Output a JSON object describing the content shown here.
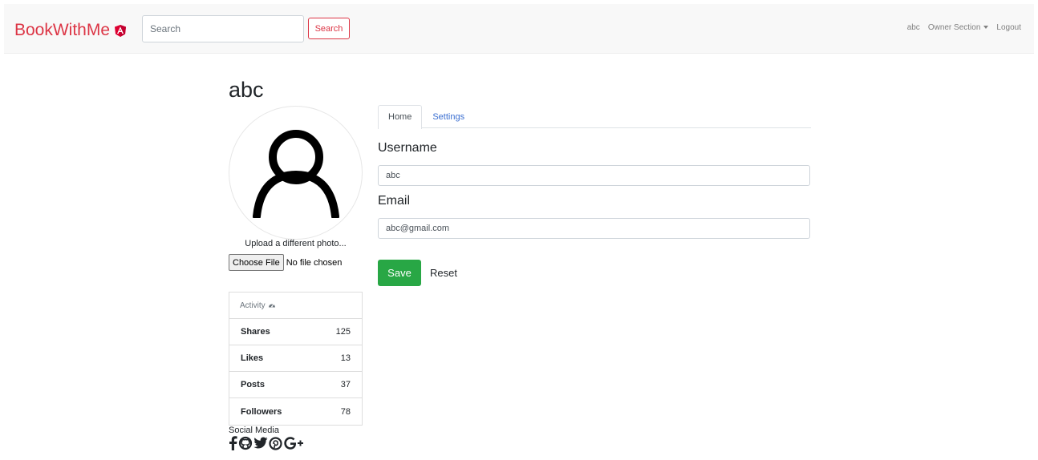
{
  "navbar": {
    "brand": "BookWithMe",
    "brand_icon": "angular-shield-icon",
    "brand_color": "#dc3545",
    "search_placeholder": "Search",
    "search_button": "Search",
    "user": "abc",
    "owner_section": "Owner Section",
    "logout": "Logout"
  },
  "profile": {
    "username_title": "abc",
    "avatar_icon": "user-silhouette-icon",
    "upload_label": "Upload a different photo...",
    "choose_file_button": "Choose File",
    "file_status": "No file chosen"
  },
  "activity": {
    "title": "Activity",
    "title_icon": "dashboard-icon",
    "rows": [
      {
        "label": "Shares",
        "value": "125"
      },
      {
        "label": "Likes",
        "value": "13"
      },
      {
        "label": "Posts",
        "value": "37"
      },
      {
        "label": "Followers",
        "value": "78"
      }
    ]
  },
  "social": {
    "label": "Social Media",
    "icons": [
      "facebook-icon",
      "github-icon",
      "twitter-icon",
      "pinterest-icon",
      "google-plus-icon"
    ]
  },
  "tabs": [
    {
      "label": "Home",
      "active": true
    },
    {
      "label": "Settings",
      "active": false
    }
  ],
  "form": {
    "username_label": "Username",
    "username_value": "abc",
    "email_label": "Email",
    "email_value": "abc@gmail.com",
    "save_button": "Save",
    "reset_button": "Reset",
    "save_color": "#28a745"
  }
}
